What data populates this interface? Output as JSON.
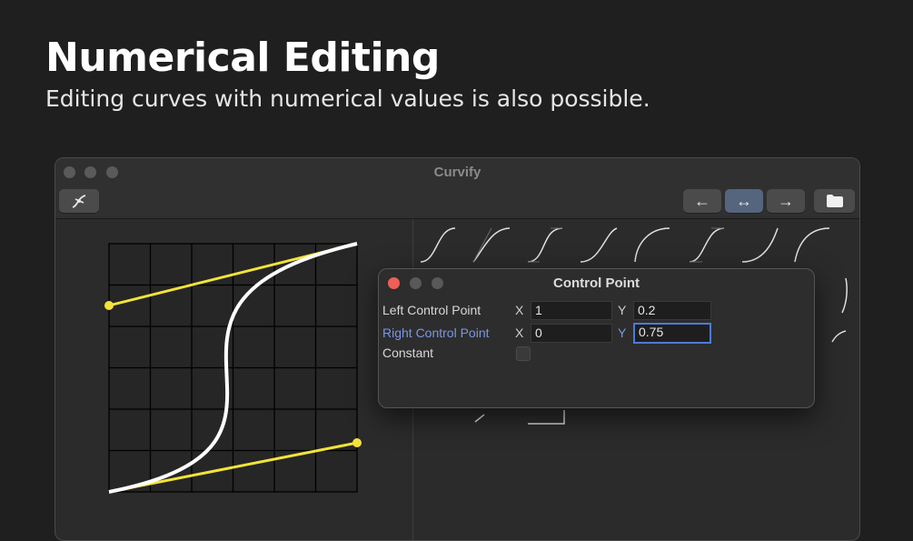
{
  "slide": {
    "title": "Numerical Editing",
    "subtitle": "Editing curves with numerical values is also possible."
  },
  "window": {
    "title": "Curvify",
    "toolbar": {
      "left_button_icon": "curve-tool-icon",
      "buttons": [
        {
          "icon": "arrow-left-icon",
          "glyph": "←",
          "active": false
        },
        {
          "icon": "arrow-left-right-icon",
          "glyph": "↔",
          "active": true
        },
        {
          "icon": "arrow-right-icon",
          "glyph": "→",
          "active": false
        },
        {
          "icon": "folder-icon",
          "active": false
        }
      ]
    }
  },
  "dialog": {
    "title": "Control Point",
    "rows": [
      {
        "label": "Left Control Point",
        "x_label": "X",
        "x_value": "1",
        "y_label": "Y",
        "y_value": "0.2",
        "highlight": false
      },
      {
        "label": "Right Control Point",
        "x_label": "X",
        "x_value": "0",
        "y_label": "Y",
        "y_value": "0.75",
        "highlight": true
      }
    ],
    "constant_label": "Constant",
    "constant_checked": false
  },
  "colors": {
    "curve": "#ffffff",
    "handle": "#f3e33a",
    "accent_blue": "#7b96e3",
    "active_button": "#55657e"
  }
}
